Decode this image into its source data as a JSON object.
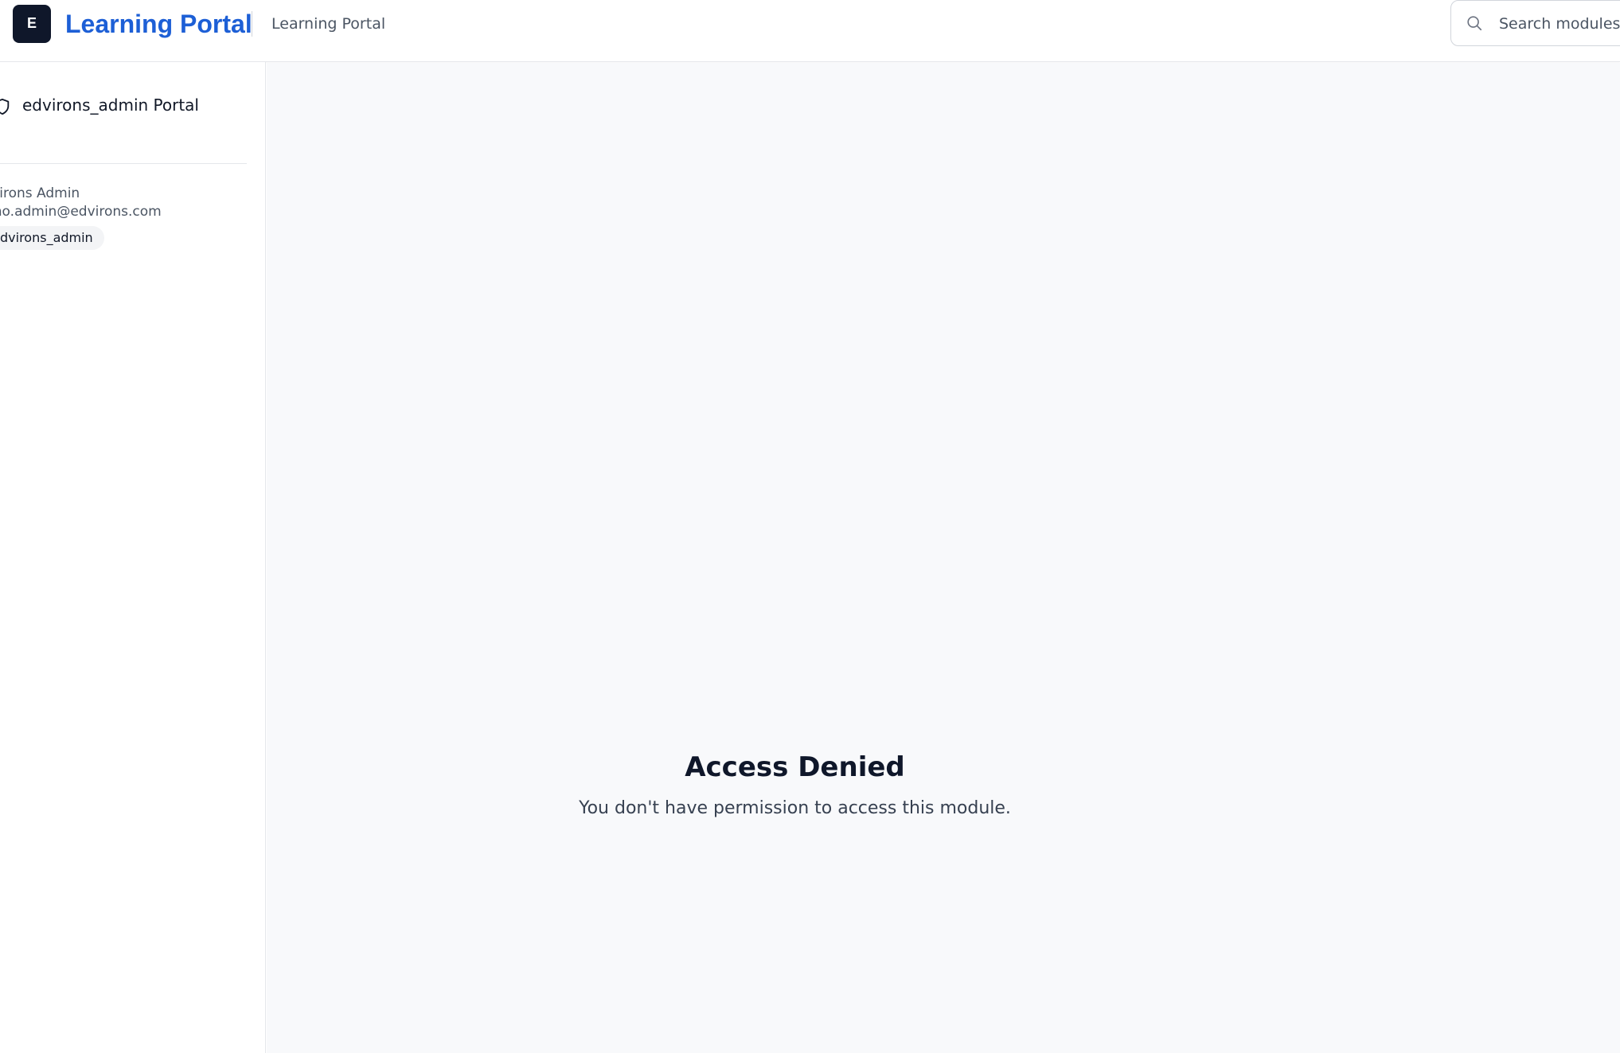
{
  "header": {
    "logo_letter": "E",
    "title": "Learning Portal",
    "subtitle": "Learning Portal",
    "search": {
      "placeholder": "Search modules,",
      "value": ""
    },
    "brand_color": "#1d5fd6"
  },
  "sidebar": {
    "portal_icon": "shield-icon",
    "portal_title": "edvirons_admin Portal",
    "user": {
      "name": "Virons Admin",
      "email": "mo.admin@edvirons.com",
      "role": "dvirons_admin"
    }
  },
  "main": {
    "title": "Access Denied",
    "message": "You don't have permission to access this module."
  }
}
